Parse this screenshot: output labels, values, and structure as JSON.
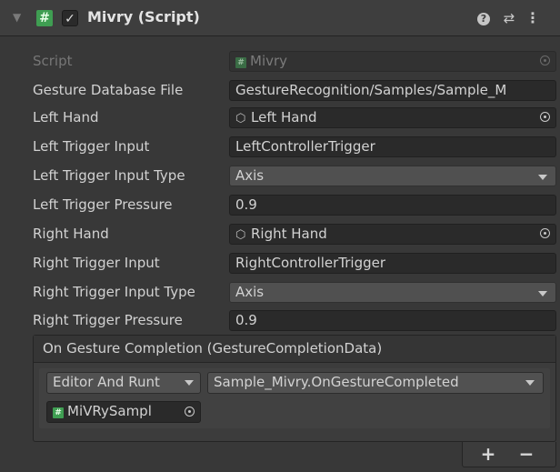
{
  "header": {
    "fold_icon": "triangle-down-icon",
    "script_icon": "hash-icon",
    "enabled_check": "✓",
    "title": "Mivry (Script)",
    "help_icon": "question-icon",
    "presets_icon": "sliders-icon",
    "menu_icon": "kebab-icon"
  },
  "fields": {
    "script": {
      "label": "Script",
      "value": "Mivry"
    },
    "gesture_db": {
      "label": "Gesture Database File",
      "value": "GestureRecognition/Samples/Sample_M"
    },
    "left_hand": {
      "label": "Left Hand",
      "value": "Left Hand"
    },
    "left_trigger_input": {
      "label": "Left Trigger Input",
      "value": "LeftControllerTrigger"
    },
    "left_trigger_type": {
      "label": "Left Trigger Input Type",
      "value": "Axis"
    },
    "left_trigger_pressure": {
      "label": "Left Trigger Pressure",
      "value": "0.9"
    },
    "right_hand": {
      "label": "Right Hand",
      "value": "Right Hand"
    },
    "right_trigger_input": {
      "label": "Right Trigger Input",
      "value": "RightControllerTrigger"
    },
    "right_trigger_type": {
      "label": "Right Trigger Input Type",
      "value": "Axis"
    },
    "right_trigger_pressure": {
      "label": "Right Trigger Pressure",
      "value": "0.9"
    }
  },
  "event": {
    "title": "On Gesture Completion (GestureCompletionData)",
    "call_state": "Editor And Runt",
    "method": "Sample_Mivry.OnGestureCompleted",
    "target": "MiVRySampl",
    "add_label": "+",
    "remove_label": "−"
  },
  "colors": {
    "background": "#383838",
    "field": "#2a2a2a",
    "script_green": "#3f9e52"
  }
}
